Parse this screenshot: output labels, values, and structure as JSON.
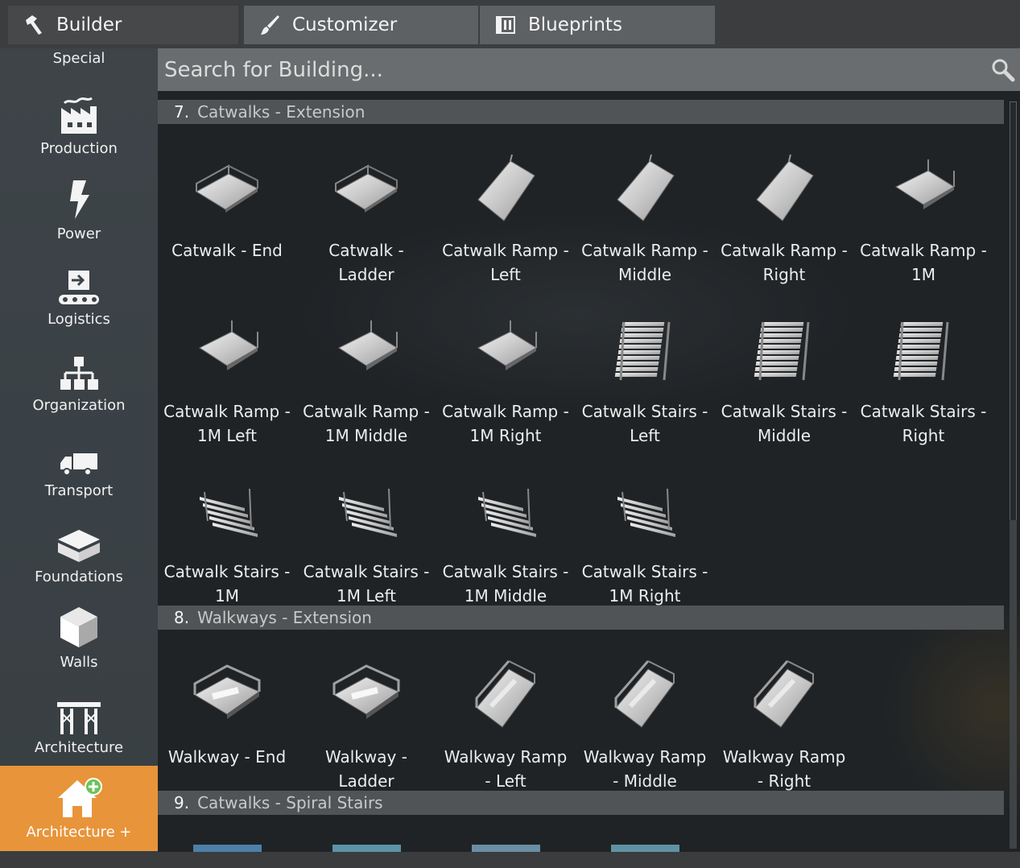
{
  "tabs": [
    {
      "label": "Builder",
      "icon": "hammer-icon",
      "active": true
    },
    {
      "label": "Customizer",
      "icon": "brush-icon",
      "active": false
    },
    {
      "label": "Blueprints",
      "icon": "blueprint-icon",
      "active": false
    }
  ],
  "sidebar": {
    "items": [
      {
        "label": "Special",
        "icon": "special-icon"
      },
      {
        "label": "Production",
        "icon": "factory-icon"
      },
      {
        "label": "Power",
        "icon": "lightning-icon"
      },
      {
        "label": "Logistics",
        "icon": "conveyor-icon"
      },
      {
        "label": "Organization",
        "icon": "org-chart-icon"
      },
      {
        "label": "Transport",
        "icon": "truck-icon"
      },
      {
        "label": "Foundations",
        "icon": "foundation-icon"
      },
      {
        "label": "Walls",
        "icon": "wall-icon"
      },
      {
        "label": "Architecture",
        "icon": "pillars-icon"
      },
      {
        "label": "Architecture +",
        "icon": "house-plus-icon",
        "active": true
      }
    ]
  },
  "search": {
    "placeholder": "Search for Building..."
  },
  "sections": [
    {
      "number": "7.",
      "title": "Catwalks - Extension",
      "items": [
        "Catwalk - End",
        "Catwalk - Ladder",
        "Catwalk Ramp - Left",
        "Catwalk Ramp - Middle",
        "Catwalk Ramp - Right",
        "Catwalk Ramp - 1M",
        "Catwalk Ramp - 1M Left",
        "Catwalk Ramp - 1M Middle",
        "Catwalk Ramp - 1M Right",
        "Catwalk Stairs - Left",
        "Catwalk Stairs - Middle",
        "Catwalk Stairs - Right",
        "Catwalk Stairs - 1M",
        "Catwalk Stairs - 1M Left",
        "Catwalk Stairs - 1M Middle",
        "Catwalk Stairs - 1M Right"
      ],
      "labels": [
        [
          "Catwalk - End"
        ],
        [
          "Catwalk -",
          "Ladder"
        ],
        [
          "Catwalk Ramp -",
          "Left"
        ],
        [
          "Catwalk Ramp -",
          "Middle"
        ],
        [
          "Catwalk Ramp -",
          "Right"
        ],
        [
          "Catwalk Ramp -",
          "1M"
        ],
        [
          "Catwalk Ramp -",
          "1M Left"
        ],
        [
          "Catwalk Ramp -",
          "1M Middle"
        ],
        [
          "Catwalk Ramp -",
          "1M Right"
        ],
        [
          "Catwalk Stairs -",
          "Left"
        ],
        [
          "Catwalk Stairs -",
          "Middle"
        ],
        [
          "Catwalk Stairs -",
          "Right"
        ],
        [
          "Catwalk Stairs -",
          "1M"
        ],
        [
          "Catwalk Stairs -",
          "1M Left"
        ],
        [
          "Catwalk Stairs -",
          "1M Middle"
        ],
        [
          "Catwalk Stairs -",
          "1M Right"
        ]
      ],
      "kinds": [
        "cw-end",
        "cw-ladder",
        "ramp",
        "ramp",
        "ramp",
        "ramp1m",
        "ramp1m",
        "ramp1m",
        "ramp1m",
        "stairs",
        "stairs",
        "stairs",
        "stairs1m",
        "stairs1m",
        "stairs1m",
        "stairs1m"
      ]
    },
    {
      "number": "8.",
      "title": "Walkways - Extension",
      "items": [
        "Walkway - End",
        "Walkway - Ladder",
        "Walkway Ramp - Left",
        "Walkway Ramp - Middle",
        "Walkway Ramp - Right"
      ],
      "labels": [
        [
          "Walkway - End"
        ],
        [
          "Walkway -",
          "Ladder"
        ],
        [
          "Walkway Ramp",
          "- Left"
        ],
        [
          "Walkway Ramp",
          "- Middle"
        ],
        [
          "Walkway Ramp",
          "- Right"
        ]
      ],
      "kinds": [
        "wk-end",
        "wk-end",
        "wk-ramp",
        "wk-ramp",
        "wk-ramp"
      ]
    },
    {
      "number": "9.",
      "title": "Catwalks - Spiral Stairs",
      "items": [],
      "labels": [],
      "kinds": []
    }
  ],
  "colors": {
    "accent": "#e8943a",
    "panel": "#1f2326",
    "header": "#515456",
    "search": "#6a6d6f"
  }
}
